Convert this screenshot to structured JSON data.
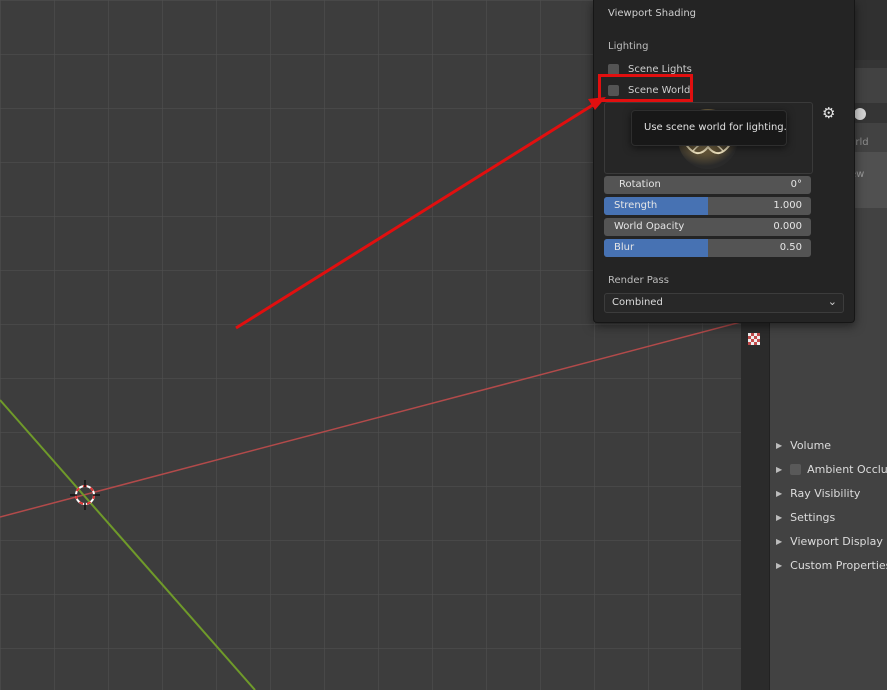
{
  "popover": {
    "title": "Viewport Shading",
    "lighting_label": "Lighting",
    "scene_lights_label": "Scene Lights",
    "scene_world_label": "Scene World",
    "rotation": {
      "label": "Rotation",
      "value": "0°"
    },
    "strength": {
      "label": "Strength",
      "value": "1.000",
      "fill_fraction": 0.5
    },
    "world_opacity": {
      "label": "World Opacity",
      "value": "0.000"
    },
    "blur": {
      "label": "Blur",
      "value": "0.50",
      "fill_fraction": 0.5
    },
    "render_pass_label": "Render Pass",
    "render_pass_value": "Combined"
  },
  "tooltip": {
    "text": "Use scene world for lighting."
  },
  "properties": {
    "partial_texts": [
      "World",
      "ew"
    ],
    "panels": [
      {
        "label": "Volume",
        "has_checkbox": false
      },
      {
        "label": "Ambient Occlusi",
        "has_checkbox": true
      },
      {
        "label": "Ray Visibility",
        "has_checkbox": false
      },
      {
        "label": "Settings",
        "has_checkbox": false
      },
      {
        "label": "Viewport Display",
        "has_checkbox": false
      },
      {
        "label": "Custom Properties",
        "has_checkbox": false
      }
    ]
  },
  "colors": {
    "annotation": "#e10f0f",
    "x_axis": "#b24a4a",
    "y_axis": "#6f9a2a",
    "slider_fill": "#4772b3"
  }
}
